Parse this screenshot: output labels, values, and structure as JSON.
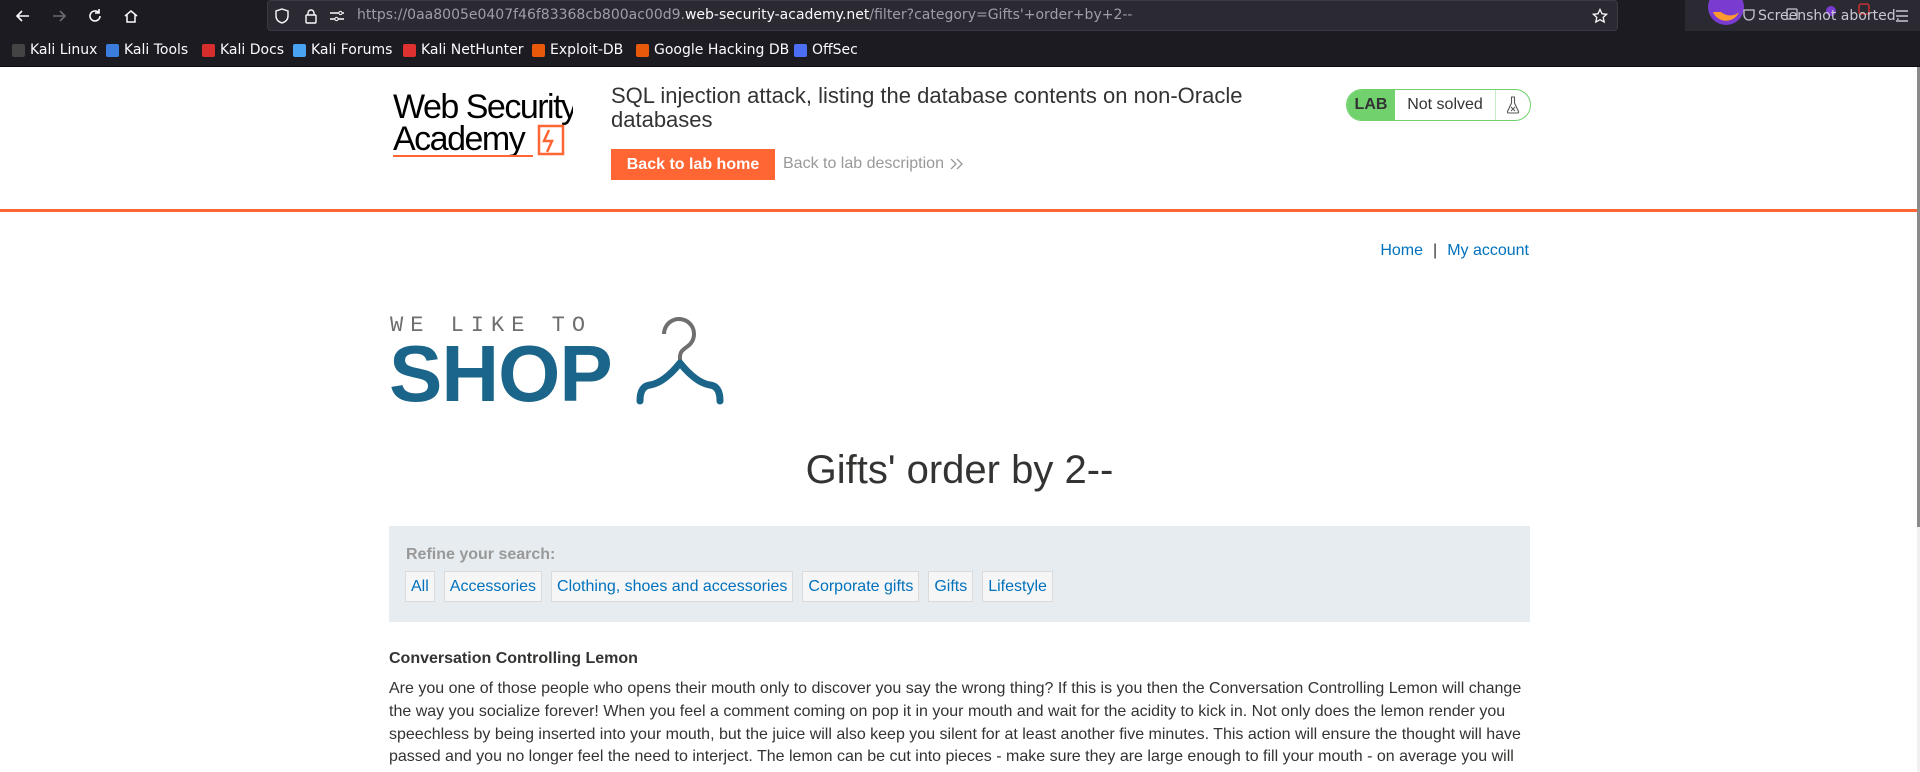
{
  "browser": {
    "url_prefix": "https://0aa8005e0407f46f83368cb800ac00d9.",
    "url_host": "web-security-academy.net",
    "url_path": "/filter?category=Gifts'+order+by+2--",
    "status_message": "Screenshot aborted.",
    "bookmarks": [
      {
        "label": "Kali Linux",
        "icon": "kali-icon",
        "color": "#ffffff"
      },
      {
        "label": "Kali Tools",
        "icon": "kali-tools-icon",
        "color": "#3b7ddd"
      },
      {
        "label": "Kali Docs",
        "icon": "kali-docs-icon",
        "color": "#d82d2d"
      },
      {
        "label": "Kali Forums",
        "icon": "kali-forums-icon",
        "color": "#4aa3f0"
      },
      {
        "label": "Kali NetHunter",
        "icon": "nethunter-icon",
        "color": "#e03131"
      },
      {
        "label": "Exploit-DB",
        "icon": "exploit-db-icon",
        "color": "#e8590c"
      },
      {
        "label": "Google Hacking DB",
        "icon": "ghdb-icon",
        "color": "#e8590c"
      },
      {
        "label": "OffSec",
        "icon": "offsec-icon",
        "color": "#4c6ef5"
      }
    ]
  },
  "lab": {
    "logo_line1": "Web Security",
    "logo_line2": "Academy",
    "title": "SQL injection attack, listing the database contents on non-Oracle databases",
    "back_button": "Back to lab home",
    "description_link": "Back to lab description",
    "badge": "LAB",
    "status": "Not solved"
  },
  "nav": {
    "home": "Home",
    "separator": "|",
    "account": "My account"
  },
  "shop_logo": {
    "tagline": "WE LIKE TO",
    "word": "SHOP"
  },
  "page_title": "Gifts' order by 2--",
  "filter": {
    "label": "Refine your search:",
    "categories": [
      "All",
      "Accessories",
      "Clothing, shoes and accessories",
      "Corporate gifts",
      "Gifts",
      "Lifestyle"
    ]
  },
  "product": {
    "name": "Conversation Controlling Lemon",
    "description": "Are you one of those people who opens their mouth only to discover you say the wrong thing? If this is you then the Conversation Controlling Lemon will change the way you socialize forever! When you feel a comment coming on pop it in your mouth and wait for the acidity to kick in. Not only does the lemon render you speechless by being inserted into your mouth, but the juice will also keep you silent for at least another five minutes. This action will ensure the thought will have passed and you no longer feel the need to interject. The lemon can be cut into pieces - make sure they are large enough to fill your mouth - on average you will"
  },
  "colors": {
    "accent": "#ff6633",
    "link": "#0071bc",
    "lab_badge": "#70d16d",
    "shop_blue": "#1a6589"
  }
}
